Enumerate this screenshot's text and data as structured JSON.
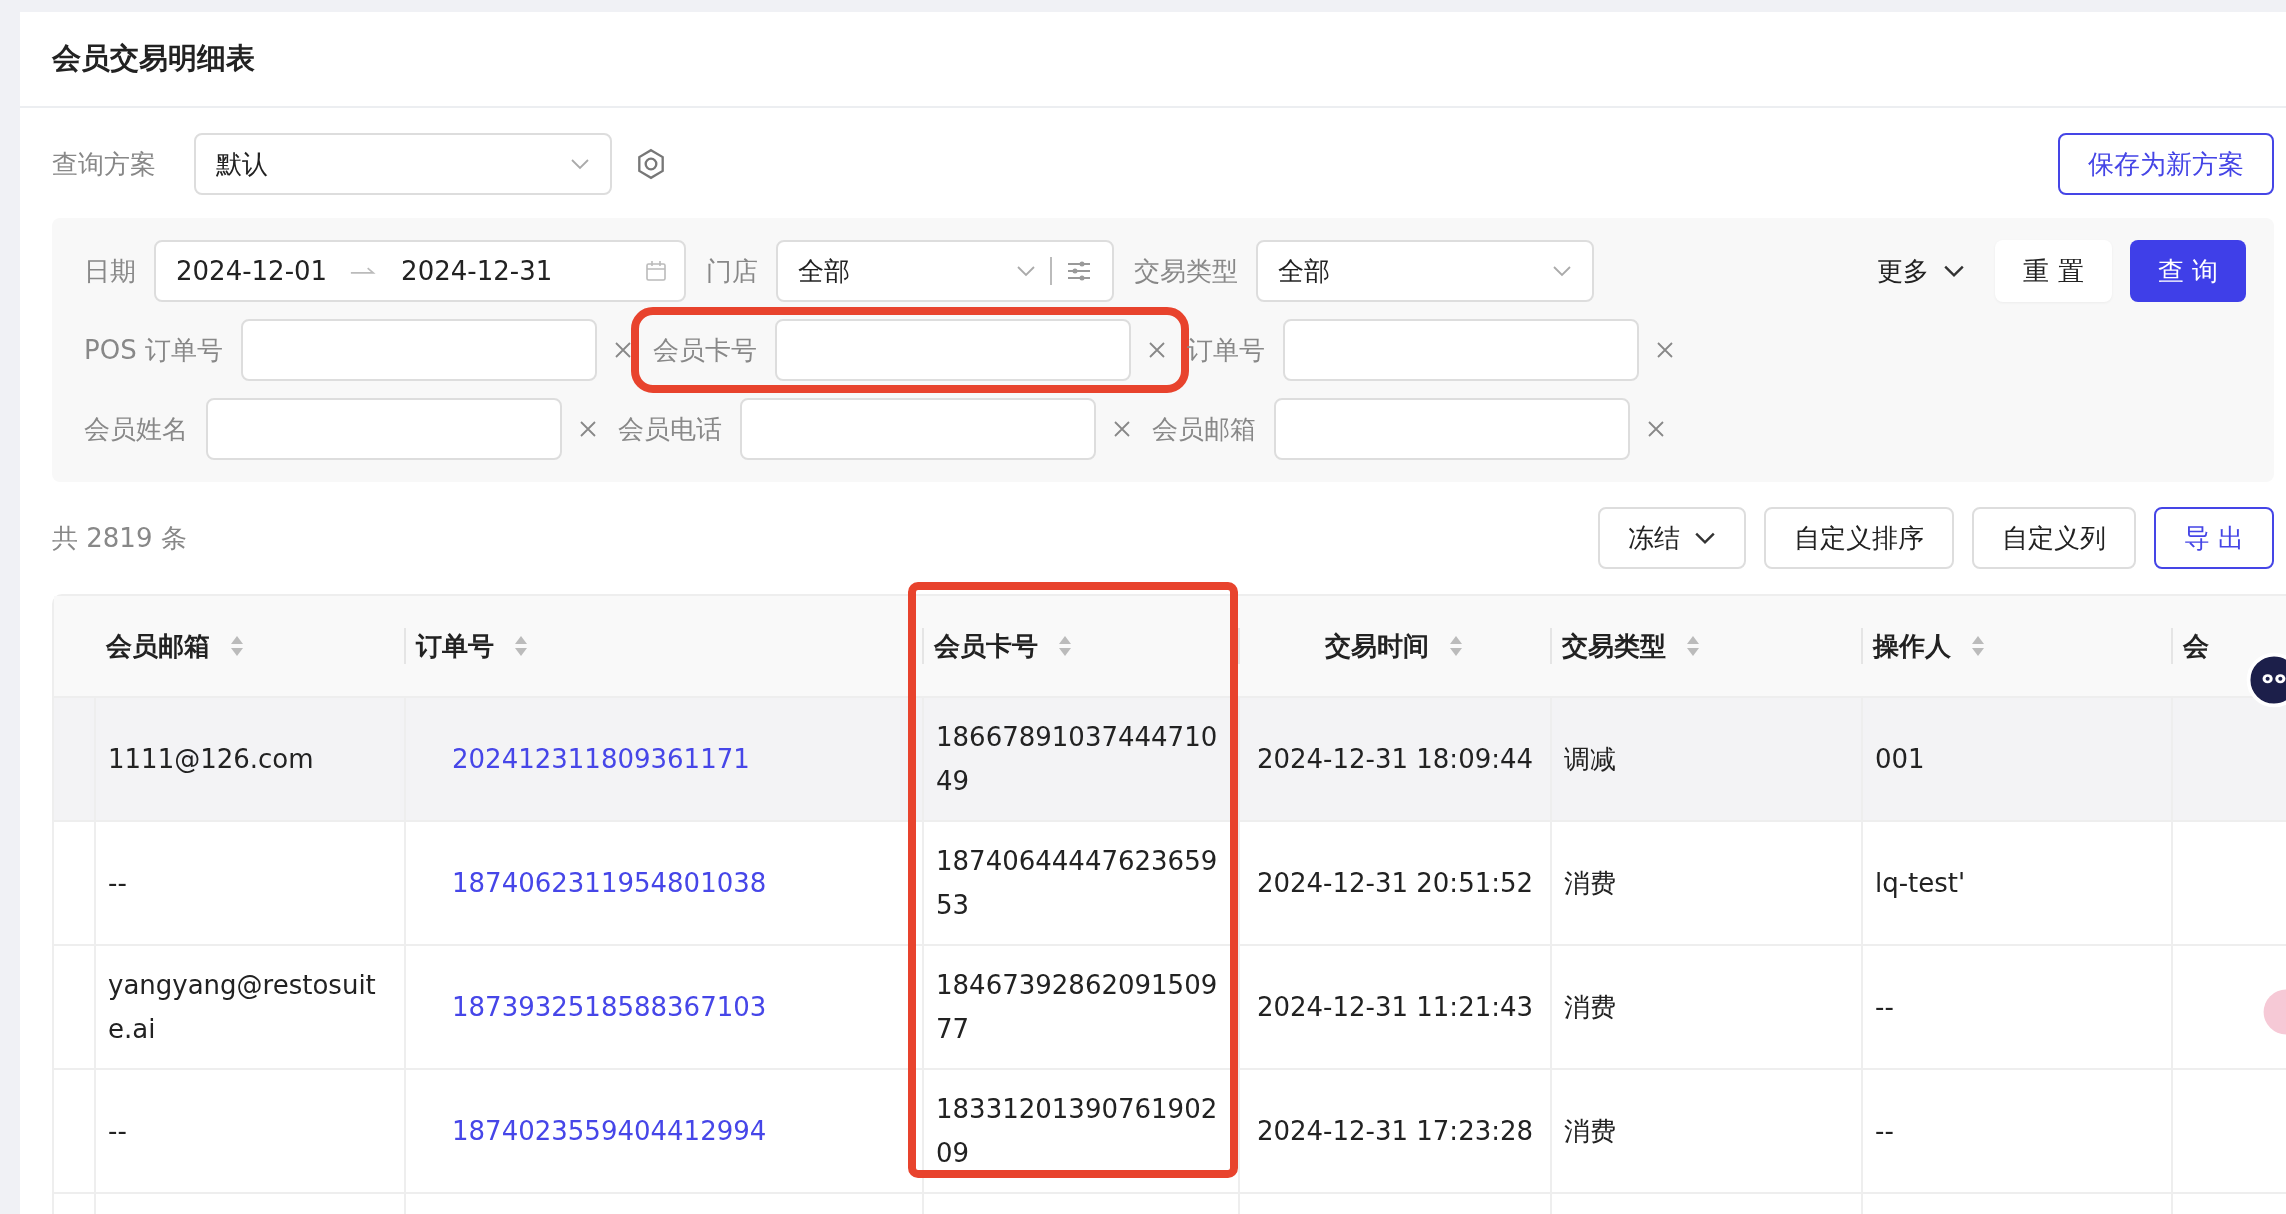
{
  "page": {
    "title": "会员交易明细表"
  },
  "scheme": {
    "label": "查询方案",
    "value": "默认",
    "save_button": "保存为新方案"
  },
  "filters": {
    "rows": [
      [
        {
          "kind": "date_range",
          "label": "日期",
          "start": "2024-12-01",
          "end": "2024-12-31",
          "highlighted": false
        },
        {
          "kind": "select",
          "label": "门店",
          "value": "全部",
          "options_button": true,
          "highlighted": false
        },
        {
          "kind": "select",
          "label": "交易类型",
          "value": "全部",
          "options_button": false,
          "highlighted": false
        }
      ],
      [
        {
          "kind": "text",
          "label": "POS 订单号",
          "highlighted": false
        },
        {
          "kind": "text",
          "label": "会员卡号",
          "highlighted": true
        },
        {
          "kind": "text",
          "label": "订单号",
          "highlighted": false
        }
      ],
      [
        {
          "kind": "text",
          "label": "会员姓名",
          "highlighted": false
        },
        {
          "kind": "text",
          "label": "会员电话",
          "highlighted": false
        },
        {
          "kind": "text",
          "label": "会员邮箱",
          "highlighted": false
        }
      ]
    ],
    "more": "更多",
    "reset": "重 置",
    "query": "查 询"
  },
  "toolbar": {
    "count": "共 2819 条",
    "buttons": [
      {
        "label": "冻结",
        "kind": "dropdown"
      },
      {
        "label": "自定义排序",
        "kind": "plain"
      },
      {
        "label": "自定义列",
        "kind": "plain"
      },
      {
        "label": "导 出",
        "kind": "primary"
      }
    ]
  },
  "table": {
    "columns": [
      {
        "label": "会员邮箱",
        "kind": "text",
        "highlighted": false
      },
      {
        "label": "订单号",
        "kind": "link",
        "highlighted": false
      },
      {
        "label": "会员卡号",
        "kind": "text",
        "highlighted": true
      },
      {
        "label": "交易时间",
        "kind": "time",
        "highlighted": false
      },
      {
        "label": "交易类型",
        "kind": "text",
        "highlighted": false
      },
      {
        "label": "操作人",
        "kind": "text",
        "highlighted": false
      },
      {
        "label": "会",
        "kind": "cut",
        "highlighted": false
      }
    ],
    "rows": [
      {
        "hovered": true,
        "cells": [
          "1111@126.com",
          "202412311809361171",
          "1866789103744471049",
          "2024-12-31 18:09:44",
          "调减",
          "001"
        ]
      },
      {
        "hovered": false,
        "cells": [
          "--",
          "1874062311954801038",
          "1874064444762365953",
          "2024-12-31 20:51:52",
          "消费",
          "lq-test'"
        ]
      },
      {
        "hovered": false,
        "cells": [
          "yangyang@restosuite.ai",
          "1873932518588367103",
          "1846739286209150977",
          "2024-12-31 11:21:43",
          "消费",
          "--"
        ]
      },
      {
        "hovered": false,
        "cells": [
          "--",
          "1874023559404412994",
          "1833120139076190209",
          "2024-12-31 17:23:28",
          "消费",
          "--"
        ]
      }
    ]
  }
}
